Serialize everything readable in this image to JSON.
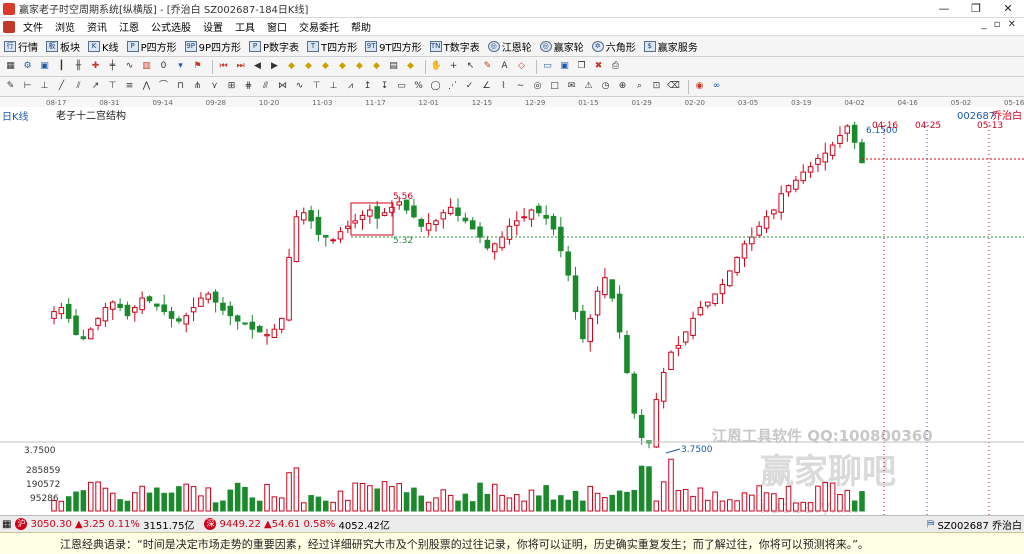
{
  "window": {
    "title": "赢家老子时空周期系统[纵横版] - [乔治白  SZ002687-184日K线]",
    "controls": [
      "—",
      "❐",
      "✕"
    ]
  },
  "menu": {
    "items": [
      "文件",
      "浏览",
      "资讯",
      "江恩",
      "公式选股",
      "设置",
      "工具",
      "窗口",
      "交易委托",
      "帮助"
    ],
    "right_controls": "_ ▫ ✕"
  },
  "toolbar1": {
    "items": [
      {
        "icon": "行",
        "label": "行情"
      },
      {
        "icon": "板",
        "label": "板块"
      },
      {
        "icon": "K",
        "label": "K线"
      },
      {
        "icon": "P",
        "label": "P四方形"
      },
      {
        "icon": "9P",
        "label": "9P四方形"
      },
      {
        "icon": "P",
        "label": "P数字表"
      },
      {
        "icon": "T",
        "label": "T四方形"
      },
      {
        "icon": "9T",
        "label": "9T四方形"
      },
      {
        "icon": "TN",
        "label": "T数字表"
      },
      {
        "icon": "◎",
        "label": "江恩轮"
      },
      {
        "icon": "◎",
        "label": "赢家轮"
      },
      {
        "icon": "✡",
        "label": "六角形"
      },
      {
        "icon": "$",
        "label": "赢家服务"
      }
    ]
  },
  "chart_header": {
    "period_label": "日K线",
    "indicator_name": "老子十二宫结构",
    "stock_code": "002687",
    "stock_name": "乔治白"
  },
  "date_axis": [
    "08-17",
    "08-31",
    "09-14",
    "09-28",
    "10-20",
    "11-03",
    "11-17",
    "12-01",
    "12-15",
    "12-29",
    "01-15",
    "01-29",
    "02-20",
    "03-05",
    "03-19",
    "04-02",
    "04-16",
    "05-02",
    "05-16"
  ],
  "annotations": {
    "box_high": "5.56",
    "box_low": "5.32",
    "low_label": "3.7500",
    "high_label": "6.1500",
    "future_dates": [
      "04-16",
      "04-25",
      "05-13"
    ],
    "price_axis_low": "3.7500"
  },
  "volume_axis": [
    "285859",
    "190572",
    "95286"
  ],
  "watermark": {
    "line1": "江恩工具软件  QQ:100800360",
    "line2": "赢家聊吧",
    "line3": "iiaoba.yi...."
  },
  "status": {
    "sh_icon": "沪",
    "sh_index": "3050.30",
    "sh_change": "▲3.25",
    "sh_pct": "0.11%",
    "sh_amount": "3151.75亿",
    "sz_icon": "深",
    "sz_index": "9449.22",
    "sz_change": "▲54.61",
    "sz_pct": "0.58%",
    "sz_amount": "4052.42亿",
    "right_stock": "SZ002687 乔治白"
  },
  "quote": "江恩经典语录：“时间是决定市场走势的重要因素，经过详细研究大市及个别股票的过往记录，你将可以证明，历史确实重复发生；而了解过往，你将可以预测将来。”。",
  "chart_data": {
    "type": "candlestick",
    "title": "老子十二宫结构",
    "x_tick_labels": [
      "08-17",
      "08-31",
      "09-14",
      "09-28",
      "10-20",
      "11-03",
      "11-17",
      "12-01",
      "12-15",
      "12-29",
      "01-15",
      "01-29",
      "02-20",
      "03-05",
      "03-19",
      "04-02",
      "04-16",
      "05-02",
      "05-16"
    ],
    "key_levels": {
      "box_high": 5.56,
      "box_low": 5.32,
      "period_low": 3.75,
      "period_high": 6.15
    },
    "close_path": [
      4.75,
      4.78,
      4.7,
      4.58,
      4.55,
      4.62,
      4.7,
      4.78,
      4.82,
      4.78,
      4.72,
      4.78,
      4.85,
      4.83,
      4.79,
      4.75,
      4.7,
      4.68,
      4.72,
      4.78,
      4.85,
      4.88,
      4.82,
      4.76,
      4.72,
      4.68,
      4.66,
      4.62,
      4.6,
      4.58,
      4.62,
      4.7,
      5.15,
      5.45,
      5.48,
      5.42,
      5.32,
      5.3,
      5.28,
      5.34,
      5.38,
      5.42,
      5.46,
      5.5,
      5.44,
      5.48,
      5.52,
      5.56,
      5.5,
      5.45,
      5.38,
      5.4,
      5.42,
      5.48,
      5.52,
      5.46,
      5.42,
      5.36,
      5.3,
      5.22,
      5.25,
      5.3,
      5.38,
      5.42,
      5.45,
      5.5,
      5.48,
      5.44,
      5.36,
      5.2,
      5.02,
      4.75,
      4.55,
      4.7,
      4.9,
      5.0,
      4.85,
      4.6,
      4.3,
      4.0,
      3.82,
      3.78,
      4.1,
      4.3,
      4.45,
      4.5,
      4.6,
      4.7,
      4.78,
      4.82,
      4.88,
      4.95,
      5.05,
      5.15,
      5.25,
      5.3,
      5.38,
      5.45,
      5.5,
      5.62,
      5.68,
      5.72,
      5.78,
      5.82,
      5.88,
      5.92,
      5.98,
      6.05,
      6.12,
      6.0,
      5.85
    ],
    "volume_axis_ticks": [
      285859,
      190572,
      95286
    ]
  }
}
